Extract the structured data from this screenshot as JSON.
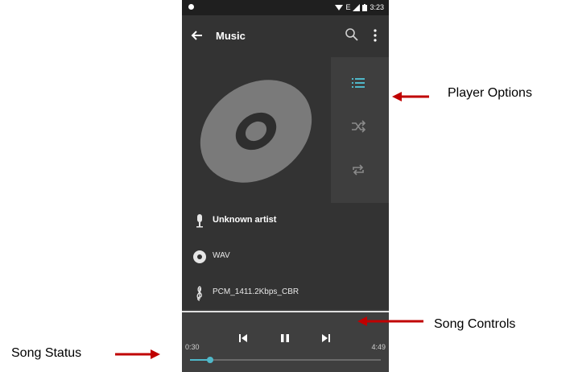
{
  "status_bar": {
    "time": "3:23",
    "network": "E"
  },
  "app_bar": {
    "title": "Music"
  },
  "player_options": [
    "playlist-icon",
    "shuffle-icon",
    "repeat-icon"
  ],
  "track_info": {
    "artist": "Unknown artist",
    "format": "WAV",
    "codec": "PCM_1411.2Kbps_CBR"
  },
  "song_controls": {
    "elapsed": "0:30",
    "duration": "4:49",
    "progress_fraction": 0.104
  },
  "annotations": {
    "player_options": "Player Options",
    "song_controls": "Song Controls",
    "song_status": "Song Status"
  },
  "colors": {
    "accent": "#4fb8c9",
    "arrow": "#c00000"
  }
}
